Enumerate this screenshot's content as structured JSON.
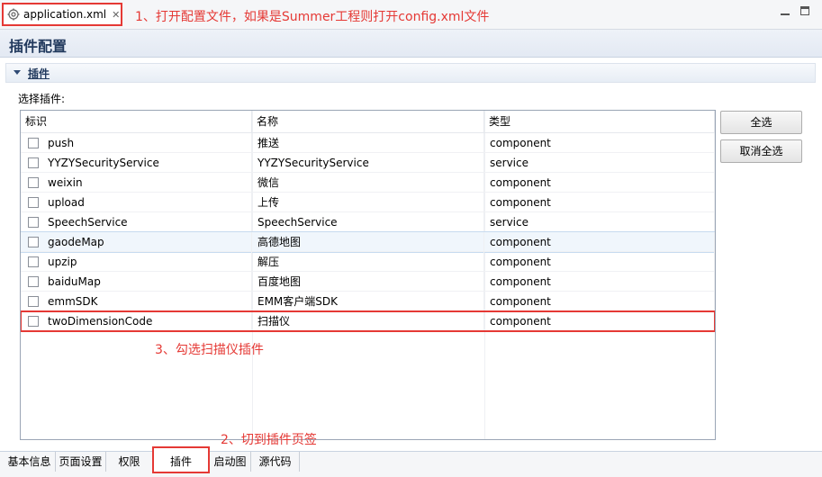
{
  "editor_tab": {
    "filename": "application.xml",
    "close": "✕"
  },
  "annotations": {
    "step1": "1、打开配置文件，如果是Summer工程则打开config.xml文件",
    "step2": "2、切到插件页签",
    "step3": "3、勾选扫描仪插件"
  },
  "header": {
    "title": "插件配置"
  },
  "section": {
    "label": "插件",
    "choose_label": "选择插件:"
  },
  "table": {
    "columns": [
      "标识",
      "名称",
      "类型"
    ],
    "rows": [
      {
        "id": "push",
        "name": "推送",
        "type": "component",
        "checked": false
      },
      {
        "id": "YYZYSecurityService",
        "name": "YYZYSecurityService",
        "type": "service",
        "checked": false
      },
      {
        "id": "weixin",
        "name": "微信",
        "type": "component",
        "checked": false
      },
      {
        "id": "upload",
        "name": "上传",
        "type": "component",
        "checked": false
      },
      {
        "id": "SpeechService",
        "name": "SpeechService",
        "type": "service",
        "checked": false
      },
      {
        "id": "gaodeMap",
        "name": "高德地图",
        "type": "component",
        "checked": false
      },
      {
        "id": "upzip",
        "name": "解压",
        "type": "component",
        "checked": false
      },
      {
        "id": "baiduMap",
        "name": "百度地图",
        "type": "component",
        "checked": false
      },
      {
        "id": "emmSDK",
        "name": "EMM客户端SDK",
        "type": "component",
        "checked": false
      },
      {
        "id": "twoDimensionCode",
        "name": "扫描仪",
        "type": "component",
        "checked": false
      }
    ]
  },
  "buttons": {
    "select_all": "全选",
    "deselect_all": "取消全选"
  },
  "bottom_tabs": [
    "基本信息",
    "页面设置",
    "权限",
    "插件",
    "启动图",
    "源代码"
  ],
  "colors": {
    "annotation": "#e53935",
    "header_text": "#223a5e"
  }
}
